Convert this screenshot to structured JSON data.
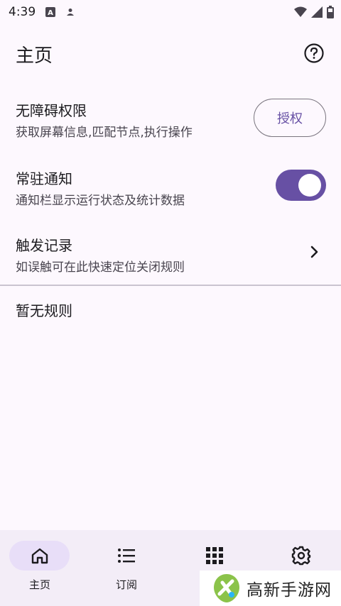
{
  "status_bar": {
    "time": "4:39",
    "icons": [
      "a-icon",
      "person-icon"
    ],
    "right_icons": [
      "wifi-icon",
      "signal-icon",
      "battery-icon"
    ]
  },
  "app_bar": {
    "title": "主页",
    "help_icon": "help-circle-icon"
  },
  "settings": {
    "accessibility": {
      "title": "无障碍权限",
      "subtitle": "获取屏幕信息,匹配节点,执行操作",
      "button_label": "授权"
    },
    "notification": {
      "title": "常驻通知",
      "subtitle": "通知栏显示运行状态及统计数据",
      "enabled": true
    },
    "trigger_log": {
      "title": "触发记录",
      "subtitle": "如误触可在此快速定位关闭规则",
      "chevron_icon": "chevron-right-icon"
    }
  },
  "rules": {
    "empty_text": "暂无规则"
  },
  "bottom_nav": {
    "items": [
      {
        "label": "主页",
        "icon": "home-icon",
        "active": true
      },
      {
        "label": "订阅",
        "icon": "list-icon",
        "active": false
      },
      {
        "label": "",
        "icon": "apps-grid-icon",
        "active": false
      },
      {
        "label": "",
        "icon": "settings-gear-icon",
        "active": false
      }
    ]
  },
  "watermark": {
    "text": "高新手游网"
  },
  "colors": {
    "primary": "#6750A4",
    "background": "#FDF8FE",
    "nav_background": "#F3EDF7",
    "nav_pill": "#E8DEF8"
  }
}
